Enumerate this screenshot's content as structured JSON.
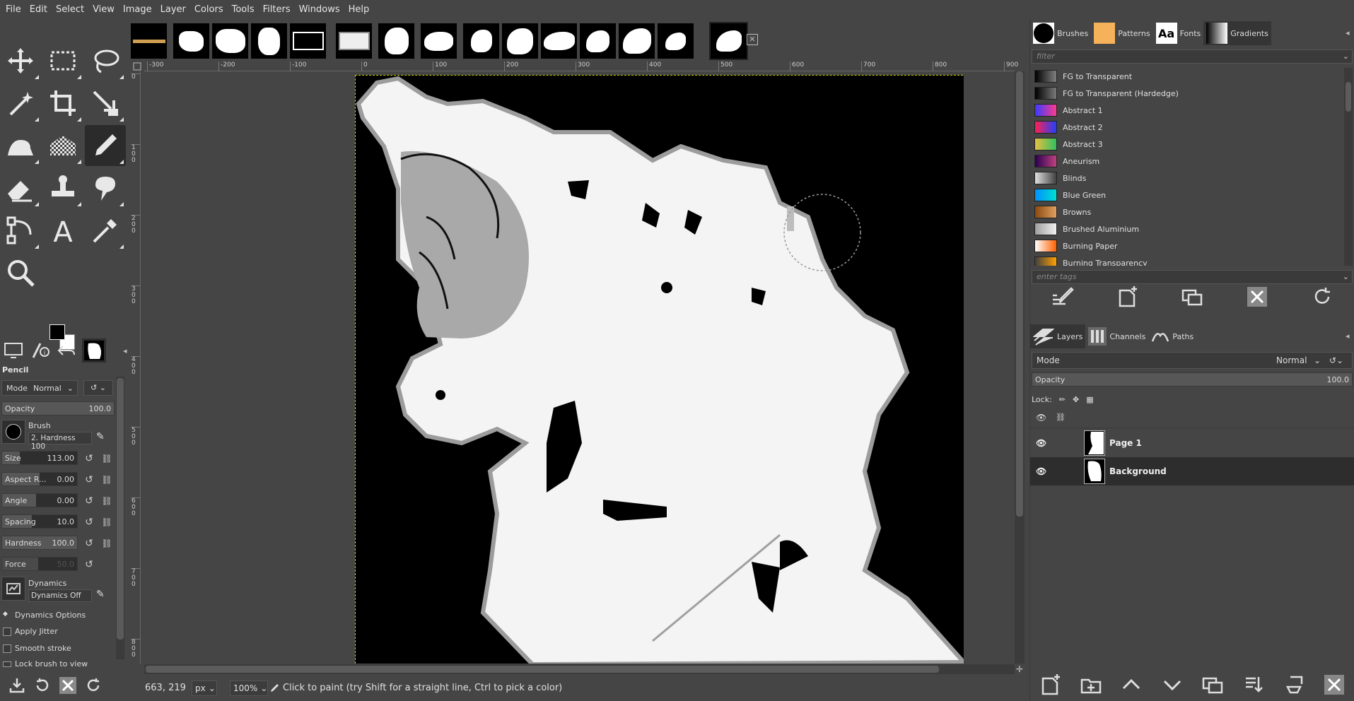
{
  "menu": [
    "File",
    "Edit",
    "Select",
    "View",
    "Image",
    "Layer",
    "Colors",
    "Tools",
    "Filters",
    "Windows",
    "Help"
  ],
  "tools": [
    {
      "name": "move-tool-icon"
    },
    {
      "name": "rect-select-icon"
    },
    {
      "name": "free-select-icon"
    },
    {
      "name": "fuzzy-select-icon"
    },
    {
      "name": "crop-icon"
    },
    {
      "name": "transform-icon"
    },
    {
      "name": "warp-icon"
    },
    {
      "name": "gradient-tool-icon"
    },
    {
      "name": "pencil-icon"
    },
    {
      "name": "eraser-icon"
    },
    {
      "name": "clone-icon"
    },
    {
      "name": "smudge-icon"
    },
    {
      "name": "paths-icon"
    },
    {
      "name": "text-icon"
    },
    {
      "name": "color-picker-icon"
    },
    {
      "name": "zoom-icon"
    }
  ],
  "tool_options": {
    "title": "Pencil",
    "mode_label": "Mode",
    "mode_value": "Normal",
    "opacity_label": "Opacity",
    "opacity_value": "100.0",
    "brush_label": "Brush",
    "brush_value": "2. Hardness 100",
    "size_label": "Size",
    "size_value": "113.00",
    "aspect_label": "Aspect R...",
    "aspect_value": "0.00",
    "angle_label": "Angle",
    "angle_value": "0.00",
    "spacing_label": "Spacing",
    "spacing_value": "10.0",
    "hardness_label": "Hardness",
    "hardness_value": "100.0",
    "force_label": "Force",
    "force_value": "50.0",
    "dynamics_label": "Dynamics",
    "dynamics_value": "Dynamics Off",
    "dynamics_options": "Dynamics Options",
    "apply_jitter": "Apply Jitter",
    "smooth_stroke": "Smooth stroke",
    "lock_brush": "Lock brush to view"
  },
  "ruler_h": [
    "-300",
    "-200",
    "-100",
    "0",
    "100",
    "200",
    "300",
    "400",
    "500",
    "600",
    "700",
    "800",
    "900"
  ],
  "ruler_v": [
    "0",
    "1\n0\n0",
    "2\n0\n0",
    "3\n0\n0",
    "4\n0\n0",
    "5\n0\n0",
    "6\n0\n0",
    "7\n0\n0",
    "8\n0\n0"
  ],
  "statusbar": {
    "coords": "663, 219",
    "unit": "px",
    "zoom": "100%",
    "message": "Click to paint (try Shift for a straight line, Ctrl to pick a color)"
  },
  "right_dock": {
    "tabs": [
      "Brushes",
      "Patterns",
      "Fonts",
      "Gradients"
    ],
    "filter_placeholder": "filter",
    "tags_placeholder": "enter tags",
    "gradients": [
      {
        "name": "FG to Transparent",
        "colors": [
          "#000000",
          "#808080"
        ]
      },
      {
        "name": "FG to Transparent (Hardedge)",
        "colors": [
          "#000000",
          "#7a7a7a"
        ]
      },
      {
        "name": "Abstract 1",
        "colors": [
          "#3a3aff",
          "#ff3a8a"
        ]
      },
      {
        "name": "Abstract 2",
        "colors": [
          "#ff2050",
          "#2040ff"
        ]
      },
      {
        "name": "Abstract 3",
        "colors": [
          "#e8c040",
          "#30c060"
        ]
      },
      {
        "name": "Aneurism",
        "colors": [
          "#2a0050",
          "#c04080"
        ]
      },
      {
        "name": "Blinds",
        "colors": [
          "#e0e0e0",
          "#404040"
        ]
      },
      {
        "name": "Blue Green",
        "colors": [
          "#0090ff",
          "#00e0d0"
        ]
      },
      {
        "name": "Browns",
        "colors": [
          "#8a4a10",
          "#e0a060"
        ]
      },
      {
        "name": "Brushed Aluminium",
        "colors": [
          "#a0a0a0",
          "#f0f0f0"
        ]
      },
      {
        "name": "Burning Paper",
        "colors": [
          "#ffffff",
          "#ff6000"
        ]
      },
      {
        "name": "Burning Transparency",
        "colors": [
          "#404040",
          "#ffa000"
        ]
      }
    ],
    "layer_tabs": [
      "Layers",
      "Channels",
      "Paths"
    ],
    "mode_label": "Mode",
    "mode_value": "Normal",
    "opacity_label": "Opacity",
    "opacity_value": "100.0",
    "lock_label": "Lock:",
    "layers": [
      {
        "name": "Page 1",
        "active": false
      },
      {
        "name": "Background",
        "active": true
      }
    ]
  }
}
